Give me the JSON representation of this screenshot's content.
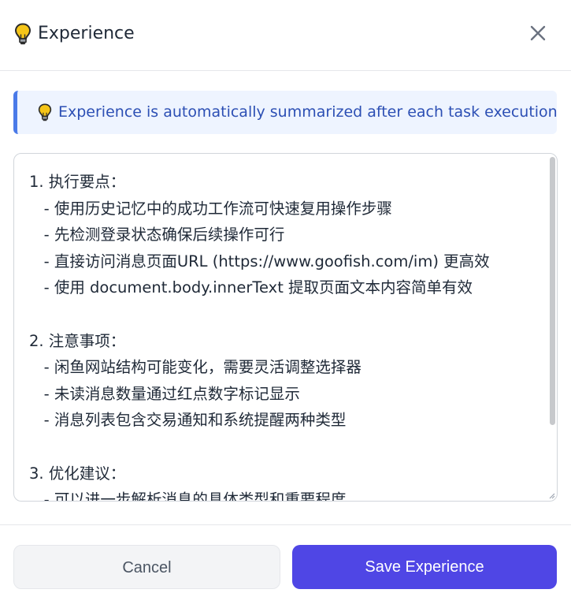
{
  "header": {
    "title": "Experience",
    "icon": "lightbulb-icon"
  },
  "info_banner": {
    "text": "Experience is automatically summarized after each task execution",
    "icon": "lightbulb-icon",
    "accent_color": "#4a7ae8"
  },
  "editor": {
    "content": "1. 执行要点：\n   - 使用历史记忆中的成功工作流可快速复用操作步骤\n   - 先检测登录状态确保后续操作可行\n   - 直接访问消息页面URL (https://www.goofish.com/im) 更高效\n   - 使用 document.body.innerText 提取页面文本内容简单有效\n\n2. 注意事项：\n   - 闲鱼网站结构可能变化，需要灵活调整选择器\n   - 未读消息数量通过红点数字标记显示\n   - 消息列表包含交易通知和系统提醒两种类型\n\n3. 优化建议：\n   - 可以进一步解析消息的具体类型和重要程度"
  },
  "footer": {
    "cancel_label": "Cancel",
    "save_label": "Save Experience",
    "save_color": "#4f46e5"
  }
}
